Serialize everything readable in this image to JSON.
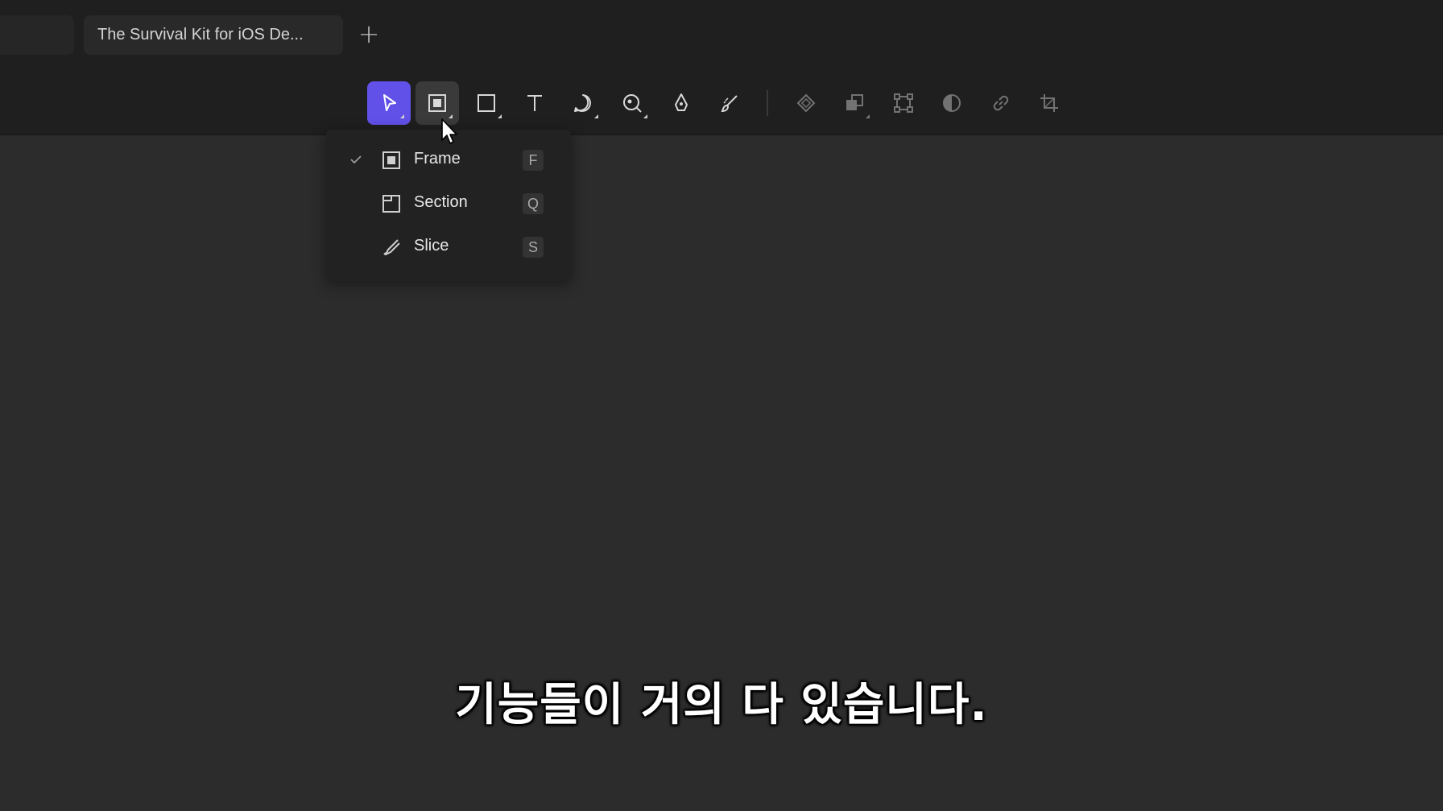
{
  "tabs": {
    "active_title": "The Survival Kit for iOS De...",
    "add_label": "+"
  },
  "toolbar": {
    "tools": [
      {
        "name": "move-tool",
        "icon": "pointer-icon",
        "active": true
      },
      {
        "name": "frame-tool",
        "icon": "frame-icon",
        "hover": true
      },
      {
        "name": "rectangle-tool",
        "icon": "rectangle-icon"
      },
      {
        "name": "text-tool",
        "icon": "text-icon"
      },
      {
        "name": "comment-tool",
        "icon": "comment-icon"
      },
      {
        "name": "search-tool",
        "icon": "search-icon"
      },
      {
        "name": "pen-tool",
        "icon": "pen-icon"
      },
      {
        "name": "draw-tool",
        "icon": "brush-icon"
      },
      {
        "name": "component-tool",
        "icon": "component-icon"
      },
      {
        "name": "boolean-tool",
        "icon": "boolean-icon"
      },
      {
        "name": "transform-tool",
        "icon": "transform-icon"
      },
      {
        "name": "mask-tool",
        "icon": "mask-icon"
      },
      {
        "name": "link-tool",
        "icon": "link-icon"
      },
      {
        "name": "crop-tool",
        "icon": "crop-icon"
      }
    ],
    "accent_color": "#6151e8"
  },
  "menu": {
    "items": [
      {
        "label": "Frame",
        "shortcut": "F",
        "checked": true,
        "icon": "frame-icon"
      },
      {
        "label": "Section",
        "shortcut": "Q",
        "checked": false,
        "icon": "section-icon"
      },
      {
        "label": "Slice",
        "shortcut": "S",
        "checked": false,
        "icon": "slice-icon"
      }
    ]
  },
  "subtitle": "기능들이 거의 다 있습니다."
}
